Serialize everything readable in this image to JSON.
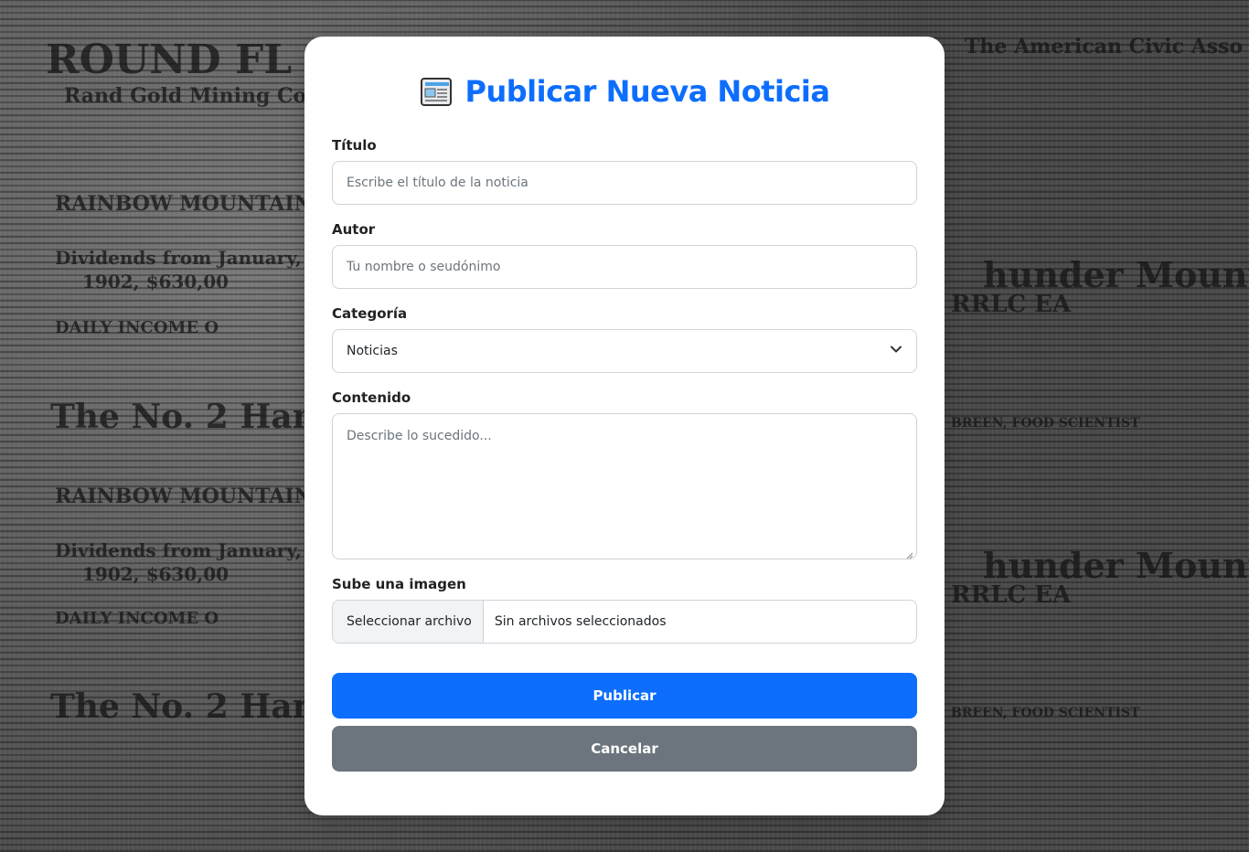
{
  "form": {
    "title": "Publicar Nueva Noticia",
    "title_icon": "newspaper-icon",
    "accent_color": "#0d6efd",
    "fields": {
      "titulo": {
        "label": "Título",
        "placeholder": "Escribe el título de la noticia"
      },
      "autor": {
        "label": "Autor",
        "placeholder": "Tu nombre o seudónimo"
      },
      "categoria": {
        "label": "Categoría",
        "selected": "Noticias"
      },
      "contenido": {
        "label": "Contenido",
        "placeholder": "Describe lo sucedido..."
      },
      "imagen": {
        "label": "Sube una imagen",
        "button": "Seleccionar archivo",
        "status": "Sin archivos seleccionados"
      }
    },
    "actions": {
      "publish": "Publicar",
      "cancel": "Cancelar",
      "cancel_color": "#6c757d"
    }
  }
}
